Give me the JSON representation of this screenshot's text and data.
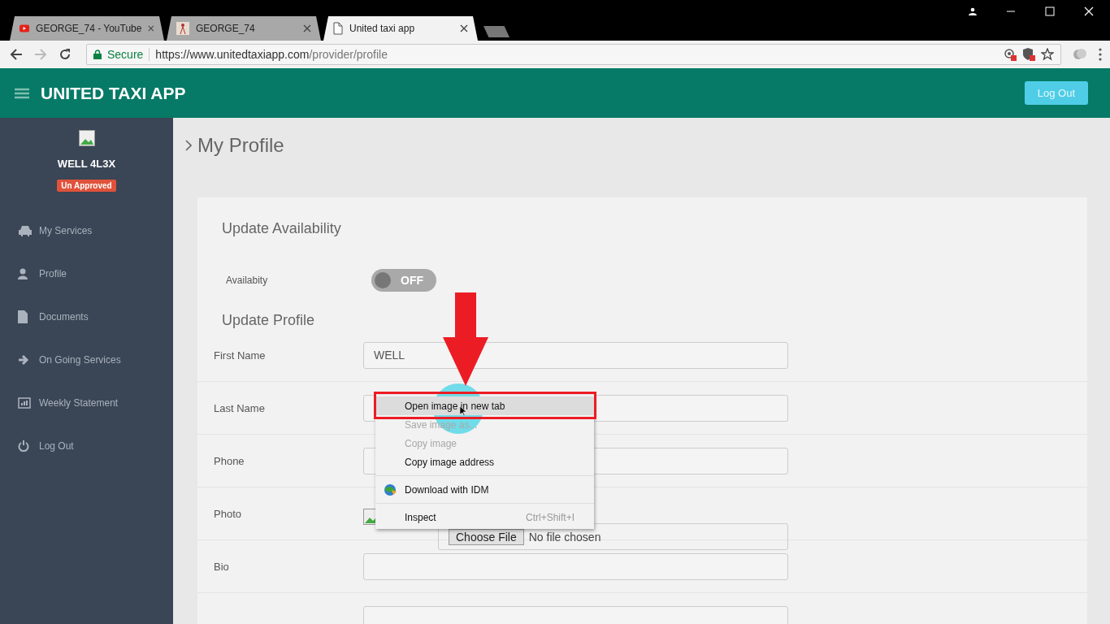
{
  "browser": {
    "tabs": [
      {
        "title": "GEORGE_74 - YouTube",
        "selected": false
      },
      {
        "title": "GEORGE_74",
        "selected": false
      },
      {
        "title": "United taxi app",
        "selected": true
      }
    ],
    "address": {
      "secure_label": "Secure",
      "url_host": "https://www.unitedtaxiapp.com",
      "url_path": "/provider/profile"
    }
  },
  "header": {
    "app_title": "UNITED TAXI APP",
    "logout_button": "Log Out"
  },
  "sidebar": {
    "name": "WELL 4L3X",
    "status_badge": "Un Approved",
    "items": [
      {
        "label": "My Services"
      },
      {
        "label": "Profile"
      },
      {
        "label": "Documents"
      },
      {
        "label": "On Going Services"
      },
      {
        "label": "Weekly Statement"
      },
      {
        "label": "Log Out"
      }
    ]
  },
  "page_title": "My Profile",
  "availability": {
    "title": "Update Availability",
    "label": "Availabity",
    "toggle": {
      "label": "OFF",
      "on": false
    }
  },
  "profile": {
    "title": "Update Profile",
    "fields": [
      {
        "label": "First Name",
        "kind": "text",
        "value": "WELL"
      },
      {
        "label": "Last Name",
        "kind": "text"
      },
      {
        "label": "Phone",
        "kind": "text"
      },
      {
        "label": "Photo",
        "kind": "file",
        "button": "Choose File",
        "status": "No file chosen"
      },
      {
        "label": "Bio",
        "kind": "text"
      },
      {
        "kind": "text"
      }
    ]
  },
  "context_menu": {
    "items": [
      {
        "kind": "item",
        "label": "Open image in new tab",
        "disabled": false,
        "selected": true
      },
      {
        "kind": "item",
        "label": "Save image as...",
        "disabled": true,
        "selected": false
      },
      {
        "kind": "item",
        "label": "Copy image",
        "disabled": true,
        "selected": false
      },
      {
        "kind": "item",
        "label": "Copy image address",
        "disabled": false,
        "selected": false
      },
      {
        "kind": "separator"
      },
      {
        "kind": "icon_item",
        "label": "Download with IDM",
        "disabled": false,
        "selected": false
      },
      {
        "kind": "separator"
      },
      {
        "kind": "item",
        "label": "Inspect",
        "shortcut": "Ctrl+Shift+I",
        "disabled": false,
        "selected": false
      }
    ]
  }
}
